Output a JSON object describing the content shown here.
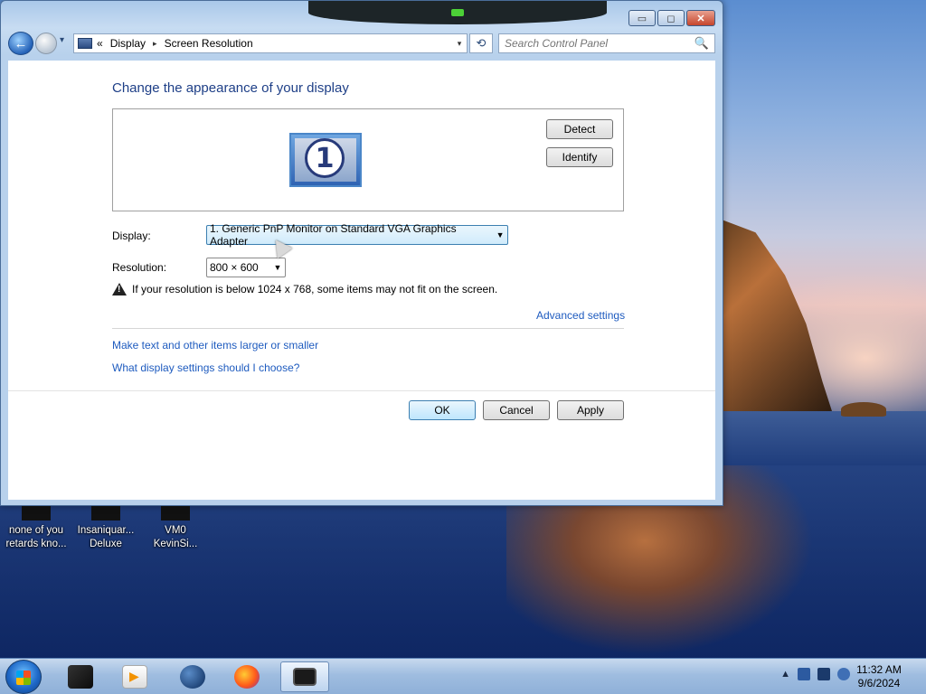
{
  "window": {
    "caption_buttons": {
      "minimize": "▭",
      "maximize": "◻",
      "close": "✕"
    }
  },
  "nav": {
    "back_icon": "back-arrow-icon",
    "address": {
      "prefix": "«",
      "crumbs": [
        "Display",
        "Screen Resolution"
      ],
      "separator": "▸",
      "dropdown": "▾"
    },
    "refresh_glyph": "⟲",
    "search": {
      "placeholder": "Search Control Panel",
      "icon": "🔍"
    }
  },
  "content": {
    "heading": "Change the appearance of your display",
    "monitor_number": "1",
    "buttons": {
      "detect": "Detect",
      "identify": "Identify",
      "ok": "OK",
      "cancel": "Cancel",
      "apply": "Apply"
    },
    "display_label": "Display:",
    "display_value": "1. Generic PnP Monitor on Standard VGA Graphics Adapter",
    "resolution_label": "Resolution:",
    "resolution_value": "800 × 600",
    "warning_text": "If your resolution is below 1024 x 768, some items may not fit on the screen.",
    "links": {
      "advanced": "Advanced settings",
      "text_size": "Make text and other items larger or smaller",
      "choose": "What display settings should I choose?"
    }
  },
  "desktop_icons": [
    {
      "label_line1": "none of you",
      "label_line2": "retards kno..."
    },
    {
      "label_line1": "Insaniquar...",
      "label_line2": "Deluxe"
    },
    {
      "label_line1": "VM0",
      "label_line2": "KevinSi..."
    }
  ],
  "taskbar": {
    "tray_arrow": "▲",
    "clock_time": "11:32 AM",
    "clock_date": "9/6/2024"
  },
  "colors": {
    "heading": "#1e3f87",
    "link": "#1e5bbf",
    "accent": "#3c7fb1"
  }
}
